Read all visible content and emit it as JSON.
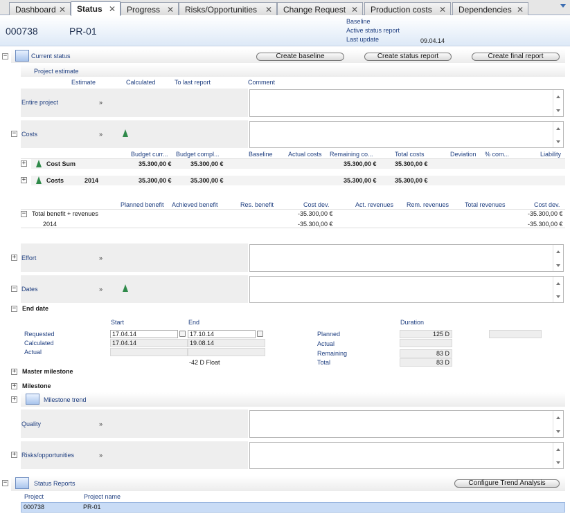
{
  "tabs": [
    {
      "label": "Dashboard"
    },
    {
      "label": "Status"
    },
    {
      "label": "Progress"
    },
    {
      "label": "Risks/Opportunities"
    },
    {
      "label": "Change Request"
    },
    {
      "label": "Production costs"
    },
    {
      "label": "Dependencies"
    }
  ],
  "header": {
    "number": "000738",
    "name": "PR-01",
    "baseline_label": "Baseline",
    "active_label": "Active status report",
    "last_update_label": "Last update",
    "last_update_value": "09.04.14"
  },
  "current_status": {
    "title": "Current status",
    "create_baseline": "Create baseline",
    "create_status_report": "Create status report",
    "create_final_report": "Create final report",
    "project_estimate": "Project estimate",
    "cols": [
      "Estimate",
      "Calculated",
      "To last report",
      "Comment"
    ],
    "entire_project": "Entire project"
  },
  "costs": {
    "label": "Costs",
    "cols": [
      "Budget curr...",
      "Budget compl...",
      "Baseline",
      "Actual costs",
      "Remaining co...",
      "Total costs",
      "Deviation",
      "% com...",
      "Liability"
    ],
    "rows": [
      {
        "name": "Cost Sum",
        "year": "",
        "budget_curr": "35.300,00 €",
        "budget_compl": "35.300,00 €",
        "remaining": "35.300,00 €",
        "total": "35.300,00 €"
      },
      {
        "name": "Costs",
        "year": "2014",
        "budget_curr": "35.300,00 €",
        "budget_compl": "35.300,00 €",
        "remaining": "35.300,00 €",
        "total": "35.300,00 €"
      }
    ]
  },
  "benefit": {
    "cols": [
      "Planned benefit",
      "Achieved benefit",
      "Res. benefit",
      "Cost dev.",
      "Act. revenues",
      "Rem. revenues",
      "Total revenues",
      "Cost dev."
    ],
    "total_label": "Total benefit + revenues",
    "total_cost_dev": "-35.300,00 €",
    "total_cost_dev2": "-35.300,00 €",
    "year": "2014",
    "year_cost_dev": "-35.300,00 €",
    "year_cost_dev2": "-35.300,00 €"
  },
  "effort": {
    "label": "Effort"
  },
  "dates": {
    "label": "Dates",
    "end_date": "End date",
    "start_col": "Start",
    "end_col": "End",
    "duration_col": "Duration",
    "requested": "Requested",
    "calculated": "Calculated",
    "actual": "Actual",
    "req_start": "17.04.14",
    "req_end": "17.10.14",
    "calc_start": "17.04.14",
    "calc_end": "19.08.14",
    "float": "-42 D Float",
    "planned": "Planned",
    "actual_d": "Actual",
    "remaining": "Remaining",
    "total": "Total",
    "planned_v": "125 D",
    "remaining_v": "83 D",
    "total_v": "83 D"
  },
  "master_milestone": "Master milestone",
  "milestone": "Milestone",
  "milestone_trend": "Milestone trend",
  "quality": {
    "label": "Quality"
  },
  "risks": {
    "label": "Risks/opportunities"
  },
  "status_reports": {
    "title": "Status Reports",
    "configure": "Configure Trend Analysis",
    "col_project": "Project",
    "col_name": "Project name",
    "row_project": "000738",
    "row_name": "PR-01"
  },
  "chevron": "»"
}
